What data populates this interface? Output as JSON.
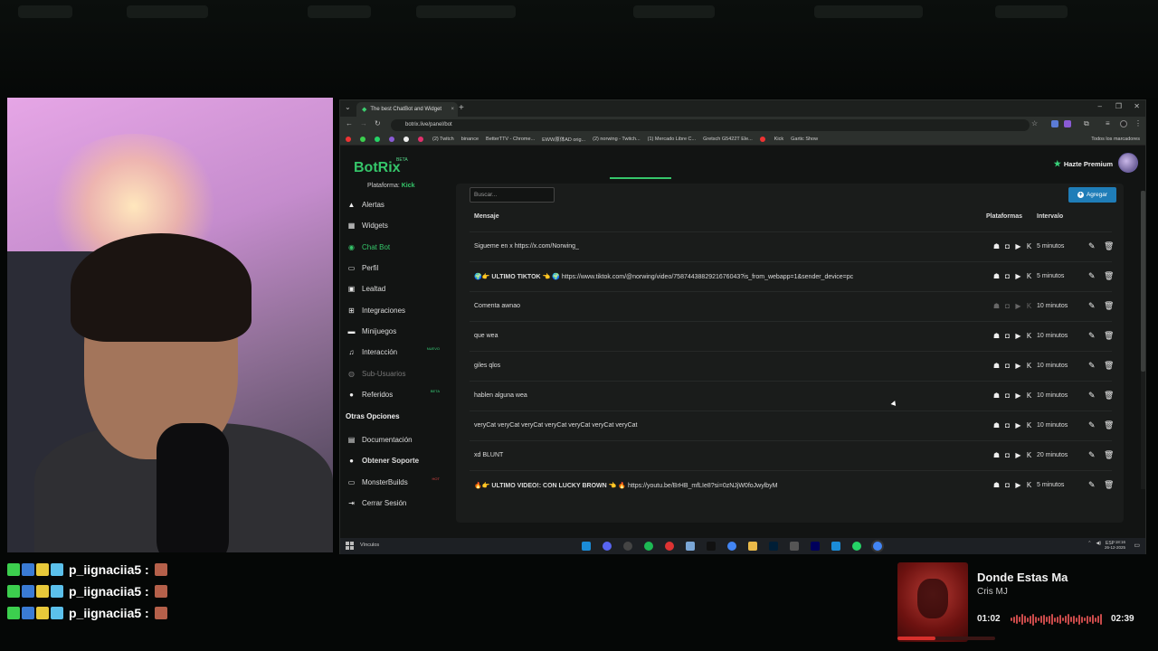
{
  "browser": {
    "tab_title": "The best ChatBot and Widget",
    "url": "botrix.live/panel/bot",
    "bookmarks": [
      "(2) Twitch",
      "binance",
      "BetterTTV - Chrome...",
      "EWW原体AD orig...",
      "(2) norwing - Twitch...",
      "(1) Mercado Libre C...",
      "Gretsch G5422T Ele...",
      "Kick",
      "Gartic Show"
    ],
    "bookmarks_folder": "Todos los marcadores"
  },
  "app": {
    "brand": "BotRix",
    "brand_badge": "BETA",
    "platform_label": "Plataforma:",
    "platform_value": "Kick",
    "premium_label": "Hazte Premium"
  },
  "sidebar": {
    "items": [
      {
        "label": "Alertas",
        "icon": "warning-icon"
      },
      {
        "label": "Widgets",
        "icon": "widgets-icon"
      },
      {
        "label": "Chat Bot",
        "icon": "robot-icon",
        "active": true
      },
      {
        "label": "Perfil",
        "icon": "profile-icon"
      },
      {
        "label": "Lealtad",
        "icon": "loyalty-icon"
      },
      {
        "label": "Integraciones",
        "icon": "integrations-icon"
      },
      {
        "label": "Minijuegos",
        "icon": "gamepad-icon"
      },
      {
        "label": "Interacción",
        "icon": "music-icon",
        "badge": "NUEVO"
      },
      {
        "label": "Sub-Usuarios",
        "icon": "users-icon",
        "disabled": true
      },
      {
        "label": "Referidos",
        "icon": "referrals-icon",
        "badge": "BETA"
      }
    ],
    "other_title": "Otras Opciones",
    "other_items": [
      {
        "label": "Documentación",
        "icon": "book-icon"
      },
      {
        "label": "Obtener Soporte",
        "icon": "support-icon"
      },
      {
        "label": "MonsterBuilds",
        "icon": "monitor-icon",
        "badge": "HOT"
      },
      {
        "label": "Cerrar Sesión",
        "icon": "logout-icon"
      }
    ]
  },
  "panel": {
    "search_placeholder": "Buscar...",
    "add_label": "Agregar",
    "headers": {
      "message": "Mensaje",
      "platforms": "Plataformas",
      "interval": "Intervalo"
    },
    "rows": [
      {
        "pre": "",
        "bold": "",
        "text": "Sigueme en x https://x.com/Norwing_",
        "interval": "5 minutos",
        "dim": false
      },
      {
        "pre": "🌍👉",
        "bold": "ULTIMO TIKTOK",
        "text": "👈 🌍 https://www.tiktok.com/@norwing/video/7587443882921676043?is_from_webapp=1&sender_device=pc",
        "interval": "5 minutos",
        "dim": false
      },
      {
        "pre": "",
        "bold": "",
        "text": "Comenta awnao",
        "interval": "10 minutos",
        "dim": true
      },
      {
        "pre": "",
        "bold": "",
        "text": "que wea",
        "interval": "10 minutos",
        "dim": false
      },
      {
        "pre": "",
        "bold": "",
        "text": "giles qlos",
        "interval": "10 minutos",
        "dim": false
      },
      {
        "pre": "",
        "bold": "",
        "text": "hablen alguna wea",
        "interval": "10 minutos",
        "dim": false
      },
      {
        "pre": "",
        "bold": "",
        "text": "veryCat veryCat veryCat veryCat veryCat veryCat veryCat",
        "interval": "10 minutos",
        "dim": false
      },
      {
        "pre": "",
        "bold": "",
        "text": "xd BLUNT",
        "interval": "20 minutos",
        "dim": false
      },
      {
        "pre": "🔥👉",
        "bold": "ULTIMO VIDEO!: CON LUCKY BROWN",
        "text": "👈 🔥 https://youtu.be/BrHB_mfLIe8?si=0zNJjW0foJwylbyM",
        "interval": "5 minutos",
        "dim": false
      }
    ]
  },
  "taskbar": {
    "label": "Vínculos",
    "lang": "ESP",
    "time": "18:16",
    "date": "26-12-2025"
  },
  "chat": {
    "messages": [
      {
        "user": "p_iignaciia5 :"
      },
      {
        "user": "p_iignaciia5 :"
      },
      {
        "user": "p_iignaciia5 :"
      }
    ]
  },
  "now_playing": {
    "title": "Donde Estas Ma",
    "artist": "Cris MJ",
    "current": "01:02",
    "total": "02:39",
    "progress": 0.39,
    "accent": "#d8302c"
  }
}
